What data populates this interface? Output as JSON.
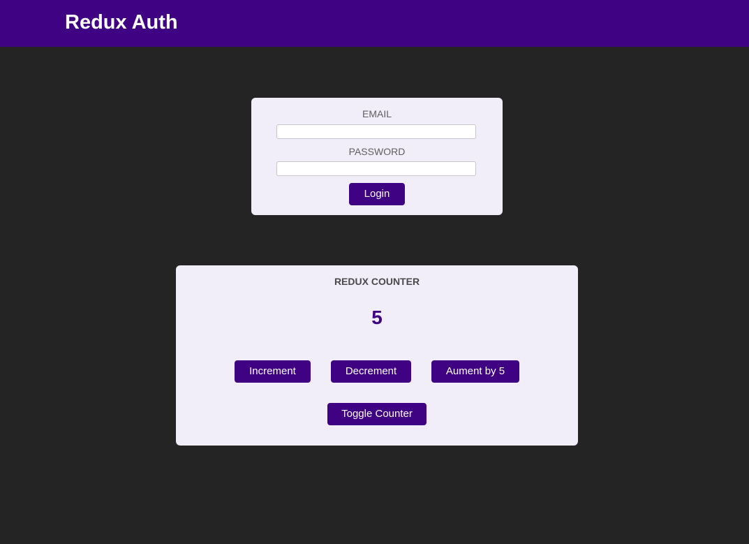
{
  "header": {
    "title": "Redux Auth"
  },
  "auth": {
    "email_label": "EMAIL",
    "email_value": "",
    "password_label": "PASSWORD",
    "password_value": "",
    "login_label": "Login"
  },
  "counter": {
    "heading": "Redux Counter",
    "value": "5",
    "increment_label": "Increment",
    "decrement_label": "Decrement",
    "increase_label": "Aument by 5",
    "toggle_label": "Toggle Counter"
  },
  "colors": {
    "brand": "#3f0283",
    "background": "#242424",
    "card": "#f1edf9"
  }
}
